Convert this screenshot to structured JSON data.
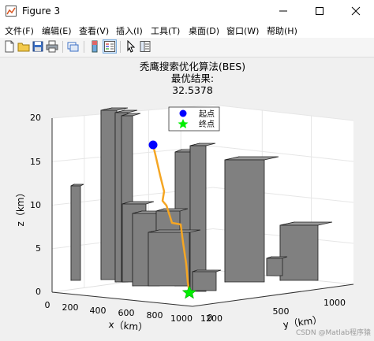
{
  "window": {
    "title": "Figure 3"
  },
  "menu": [
    {
      "label": "文件(F)"
    },
    {
      "label": "编辑(E)"
    },
    {
      "label": "查看(V)"
    },
    {
      "label": "插入(I)"
    },
    {
      "label": "工具(T)"
    },
    {
      "label": "桌面(D)"
    },
    {
      "label": "窗口(W)"
    },
    {
      "label": "帮助(H)"
    }
  ],
  "toolbar_icons": [
    "new-file-icon",
    "open-folder-icon",
    "save-icon",
    "print-icon",
    "link-plot-icon",
    "insert-colorbar-icon",
    "insert-legend-icon",
    "pointer-icon",
    "property-inspector-icon"
  ],
  "plot": {
    "title_line1": "秃鹰搜索优化算法(BES)",
    "title_line2": "最优结果:",
    "title_line3": "32.5378",
    "xlabel": "x（km）",
    "ylabel": "y（km）",
    "zlabel": "z（km）",
    "legend": [
      {
        "label": "起点",
        "marker": "circle",
        "color": "#0000ff"
      },
      {
        "label": "终点",
        "marker": "star",
        "color": "#00ff00"
      }
    ],
    "path_color": "#f5a623",
    "building_color": "#808080",
    "watermark": "CSDN @Matlab程序猿",
    "z_ticks": [
      "0",
      "5",
      "10",
      "15",
      "20"
    ],
    "x_ticks": [
      "0",
      "200",
      "400",
      "600",
      "800",
      "1000",
      "1200"
    ],
    "y_ticks": [
      "500",
      "1000"
    ],
    "y_tick_zero": "0",
    "chart_data": {
      "type": "3d-bar-scene",
      "title": "秃鹰搜索优化算法(BES) 最优结果: 32.5378",
      "xlabel": "x（km）",
      "ylabel": "y（km）",
      "zlabel": "z（km）",
      "zlim": [
        0,
        20
      ],
      "xlim": [
        0,
        1200
      ],
      "ylim": [
        0,
        1000
      ],
      "start_z": 16.5,
      "grid": true,
      "legend_position": "top"
    }
  }
}
